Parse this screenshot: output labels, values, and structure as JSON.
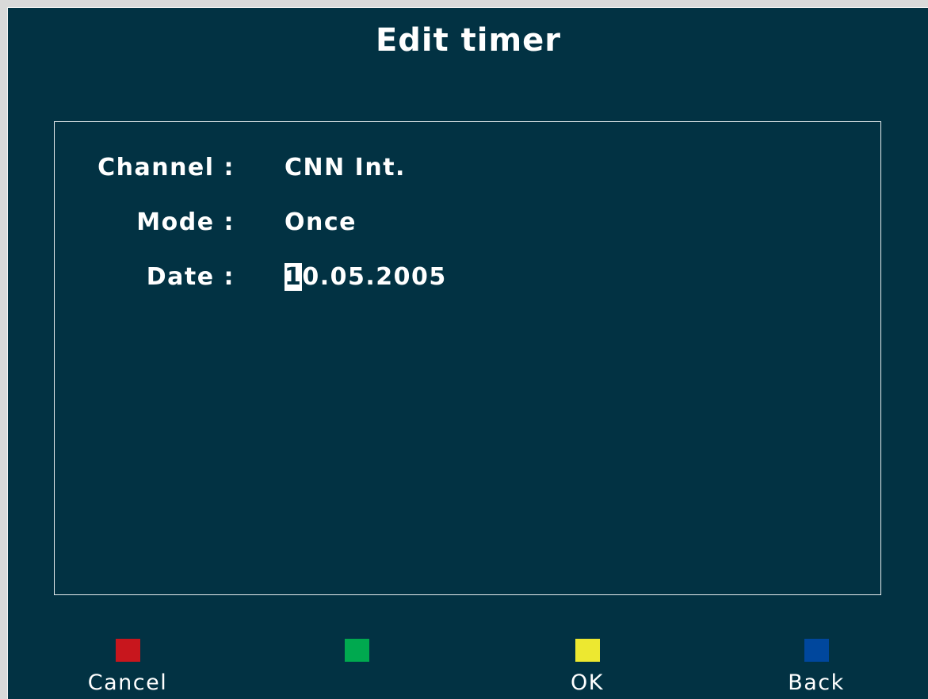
{
  "window": {
    "title": "Edit timer"
  },
  "form": {
    "fields": [
      {
        "label": "Channel :",
        "value": "CNN Int."
      },
      {
        "label": "Mode :",
        "value": "Once"
      },
      {
        "label": "Date :",
        "value_cursor": "1",
        "value_rest": "0.05.2005"
      }
    ]
  },
  "buttons": [
    {
      "label": "Cancel",
      "color": "#c8161d"
    },
    {
      "label": "",
      "color": "#00a94f"
    },
    {
      "label": "OK",
      "color": "#ede830"
    },
    {
      "label": "Back",
      "color": "#00479d"
    }
  ]
}
